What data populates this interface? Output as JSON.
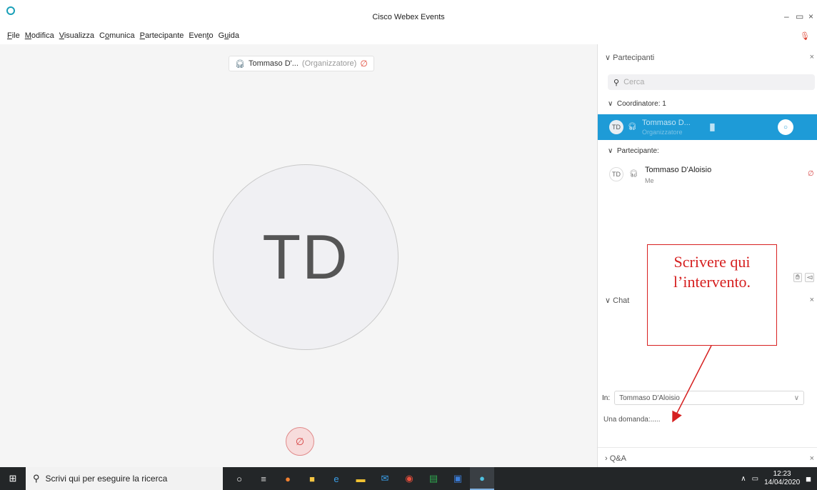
{
  "window": {
    "title": "Cisco Webex Events",
    "minimize": "–",
    "maximize": "▭",
    "close": "×"
  },
  "menu": [
    {
      "label": "File",
      "u": "F"
    },
    {
      "label": "Modifica",
      "u": "M"
    },
    {
      "label": "Visualizza",
      "u": "V"
    },
    {
      "label": "Comunica",
      "u": "o"
    },
    {
      "label": "Partecipante",
      "u": "P"
    },
    {
      "label": "Evento",
      "u": "t"
    },
    {
      "label": "Guida",
      "u": "u"
    }
  ],
  "stage": {
    "speaker_name": "Tommaso D'...",
    "speaker_role": "(Organizzatore)",
    "avatar_initials": "TD"
  },
  "participants_panel": {
    "title": "Partecipanti",
    "search_placeholder": "Cerca",
    "group_host": "Coordinatore: 1",
    "host": {
      "initials": "TD",
      "name": "Tommaso D...",
      "role": "Organizzatore"
    },
    "group_attendee": "Partecipante:",
    "attendee": {
      "initials": "TD",
      "name": "Tommaso D'Aloisio",
      "sub": "Me"
    }
  },
  "chat_panel": {
    "title": "Chat",
    "to_label": "In:",
    "to_value": "Tommaso D'Aloisio",
    "message": "Una domanda:....."
  },
  "qa_panel": {
    "title": "Q&A"
  },
  "annotation": {
    "line1": "Scrivere qui",
    "line2": "l’intervento."
  },
  "taskbar": {
    "search_placeholder": "Scrivi qui per eseguire la ricerca",
    "time": "12:23",
    "date": "14/04/2020"
  },
  "colors": {
    "accent": "#1e9bd7",
    "annotation": "#d62020",
    "taskbar": "#232628"
  }
}
